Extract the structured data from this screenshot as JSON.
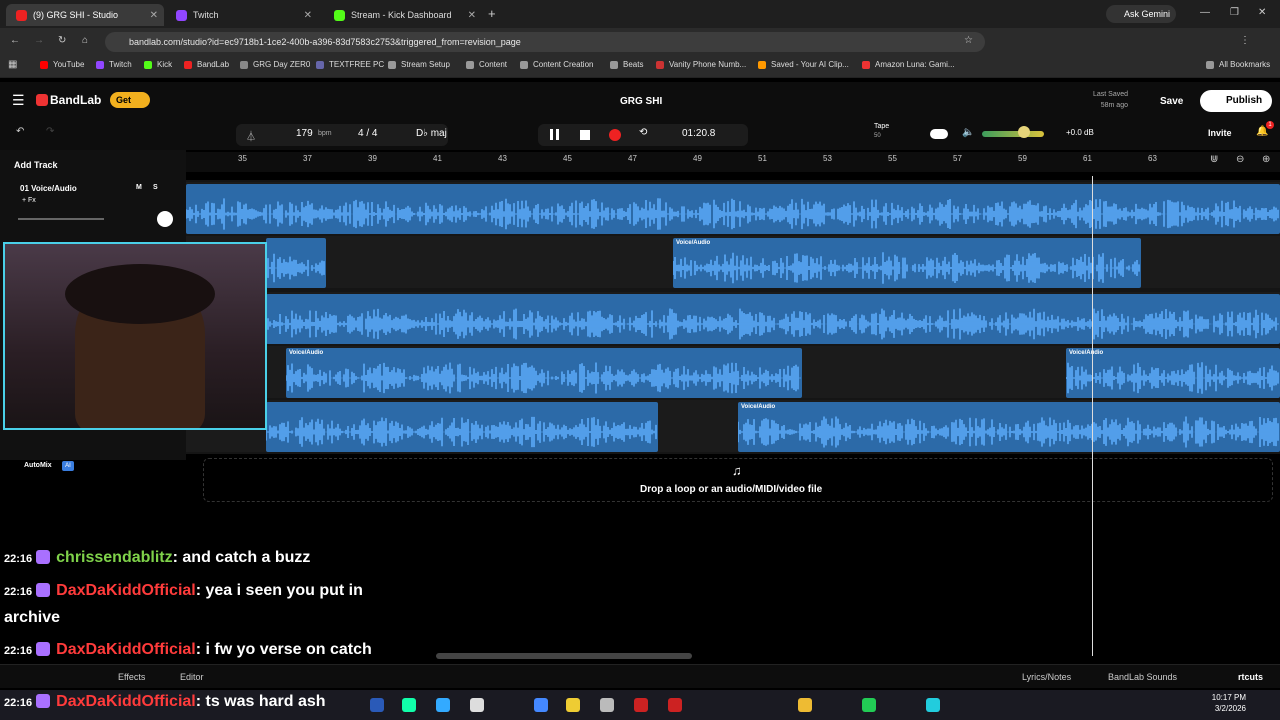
{
  "tabs": [
    {
      "label": "(9) GRG SHI - Studio",
      "active": true
    },
    {
      "label": "Twitch"
    },
    {
      "label": "Stream - Kick Dashboard"
    }
  ],
  "ask_gemini": "Ask Gemini",
  "url": "bandlab.com/studio?id=ec9718b1-1ce2-400b-a396-83d7583c2753&triggered_from=revision_page",
  "bookmarks": [
    "YouTube",
    "Twitch",
    "Kick",
    "BandLab",
    "GRG Day ZER0",
    "TEXTFREE PC",
    "Stream Setup",
    "Content",
    "Content Creation",
    "Beats",
    "Vanity Phone Numb...",
    "Saved - Your AI Clip...",
    "Amazon Luna: Gami..."
  ],
  "all_bookmarks": "All Bookmarks",
  "app": {
    "brand": "BandLab",
    "get": "Get",
    "title": "GRG SHI",
    "last_saved_label": "Last Saved",
    "last_saved": "58m ago",
    "save": "Save",
    "publish": "Publish",
    "invite": "Invite",
    "notif": "1"
  },
  "transport": {
    "bpm": "179",
    "bpm_unit": "bpm",
    "sig": "4 / 4",
    "key": "D♭ maj",
    "time": "01:20.8",
    "tape": "Tape",
    "tape_sub": "50",
    "volume": "+0.0 dB"
  },
  "ruler": [
    "35",
    "37",
    "39",
    "41",
    "43",
    "45",
    "47",
    "49",
    "51",
    "53",
    "55",
    "57",
    "59",
    "61",
    "63"
  ],
  "tracks_panel": {
    "add_track": "Add Track",
    "track_name": "01  Voice/Audio",
    "fx": "+ Fx",
    "m": "M",
    "s": "S",
    "automix": "AutoMix",
    "ai": "AI"
  },
  "clip_label": "Voice/Audio",
  "drop": "Drop a loop or an audio/MIDI/video file",
  "chat": [
    {
      "time": "22:16",
      "user": "chrissendablitz",
      "color": "#7fd24a",
      "text": ": and catch a buzz"
    },
    {
      "time": "22:16",
      "user": "DaxDaKiddOfficial",
      "color": "#ff3b3b",
      "text": ": yea i seen you put in archive"
    },
    {
      "time": "22:16",
      "user": "DaxDaKiddOfficial",
      "color": "#ff3b3b",
      "text": ": i fw yo verse on catch a buzz"
    },
    {
      "time": "22:16",
      "user": "DaxDaKiddOfficial",
      "color": "#ff3b3b",
      "text": ": ts was hard ash"
    }
  ],
  "bottom": {
    "effects": "Effects",
    "editor": "Editor",
    "lyrics": "Lyrics/Notes",
    "sounds": "BandLab Sounds",
    "shortcuts": "rtcuts"
  },
  "taskbar": {
    "time": "10:17 PM",
    "date": "3/2/2026"
  }
}
